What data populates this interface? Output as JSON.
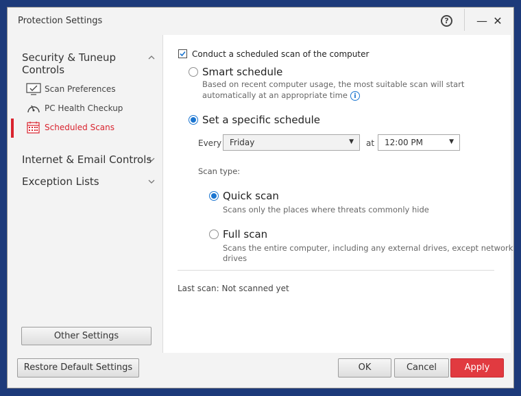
{
  "window": {
    "title": "Protection Settings",
    "help_icon": "question-circle-icon",
    "help_glyph": "?",
    "minimize_glyph": "—",
    "close_glyph": "✕"
  },
  "sidebar": {
    "sections": [
      {
        "label": "Security & Tuneup Controls",
        "expanded": true
      },
      {
        "label": "Internet & Email Controls",
        "expanded": false
      },
      {
        "label": "Exception Lists",
        "expanded": false
      }
    ],
    "items": [
      {
        "label": "Scan Preferences",
        "icon": "monitor-check-icon",
        "active": false
      },
      {
        "label": "PC Health Checkup",
        "icon": "gauge-icon",
        "active": false
      },
      {
        "label": "Scheduled Scans",
        "icon": "calendar-icon",
        "active": true
      }
    ],
    "other_settings_label": "Other Settings"
  },
  "main": {
    "conduct_label": "Conduct a scheduled scan of the computer",
    "conduct_checked": true,
    "smart_schedule": {
      "label": "Smart schedule",
      "desc_line1": "Based on recent computer usage, the most suitable scan will start",
      "desc_line2": "automatically at an appropriate time",
      "selected": false
    },
    "specific_schedule": {
      "label": "Set a specific schedule",
      "selected": true,
      "every_label": "Every",
      "day_value": "Friday",
      "at_label": "at",
      "time_value": "12:00 PM"
    },
    "scan_type_label": "Scan type:",
    "quick_scan": {
      "label": "Quick scan",
      "desc": "Scans only the places where threats commonly hide",
      "selected": true
    },
    "full_scan": {
      "label": "Full scan",
      "desc_line1": "Scans the entire computer, including any external drives, except network",
      "desc_line2": "drives",
      "selected": false
    },
    "last_scan": "Last scan: Not scanned yet"
  },
  "footer": {
    "restore_label": "Restore Default Settings",
    "ok_label": "OK",
    "cancel_label": "Cancel",
    "apply_label": "Apply"
  },
  "colors": {
    "accent_red": "#d9232e",
    "apply_red": "#e13a40",
    "radio_blue": "#1b75d0",
    "desktop_blue": "#1d3a7a"
  }
}
